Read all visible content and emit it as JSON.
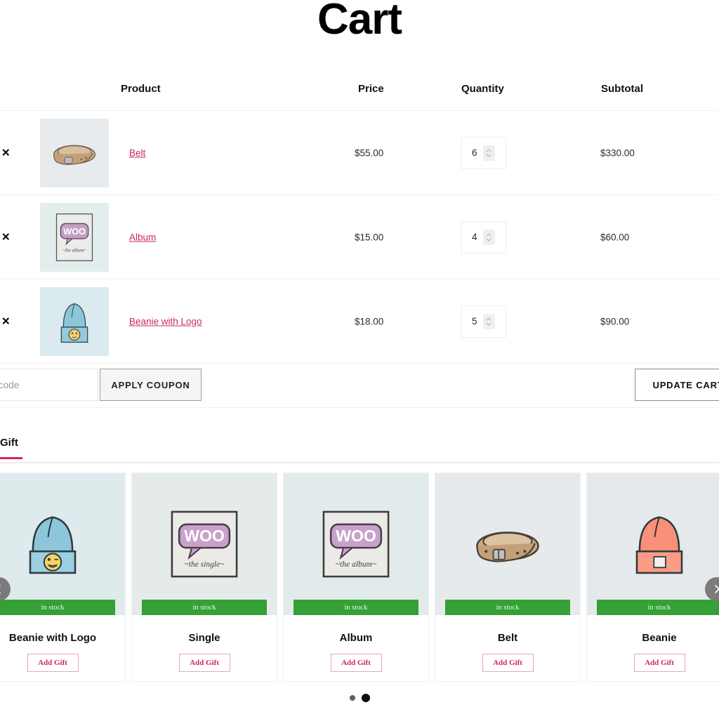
{
  "page": {
    "title": "Cart"
  },
  "cart": {
    "headers": {
      "product": "Product",
      "price": "Price",
      "quantity": "Quantity",
      "subtotal": "Subtotal"
    },
    "remove_icon": "close-x-icon",
    "items": [
      {
        "name": "Belt",
        "price": "$55.00",
        "quantity": "6",
        "subtotal": "$330.00",
        "thumb": "belt-thumbnail"
      },
      {
        "name": "Album",
        "price": "$15.00",
        "quantity": "4",
        "subtotal": "$60.00",
        "thumb": "album-thumbnail"
      },
      {
        "name": "Beanie with Logo",
        "price": "$18.00",
        "quantity": "5",
        "subtotal": "$90.00",
        "thumb": "beanie-with-logo-thumbnail"
      }
    ]
  },
  "coupon": {
    "placeholder": "Coupon code",
    "value": "",
    "apply_label": "APPLY COUPON",
    "update_label": "UPDATE CART"
  },
  "gift_section": {
    "tab_label": "Gift",
    "stock_label": "in stock",
    "add_label": "Add Gift",
    "cards": [
      {
        "title": "Beanie with Logo",
        "stock": "in stock",
        "button": "Add Gift"
      },
      {
        "title": "Single",
        "stock": "in stock",
        "button": "Add Gift"
      },
      {
        "title": "Album",
        "stock": "in stock",
        "button": "Add Gift"
      },
      {
        "title": "Belt",
        "stock": "in stock",
        "button": "Add Gift"
      },
      {
        "title": "Beanie",
        "stock": "in stock",
        "button": "Add Gift"
      }
    ],
    "prev_icon": "chevron-left-icon",
    "next_icon": "chevron-right-icon",
    "pagination": {
      "count": 2,
      "active_index": 1
    }
  },
  "colors": {
    "accent_pink": "#cc2863",
    "stock_green": "#35a035",
    "text_dark": "#111111",
    "divider": "#f1f1f3"
  }
}
